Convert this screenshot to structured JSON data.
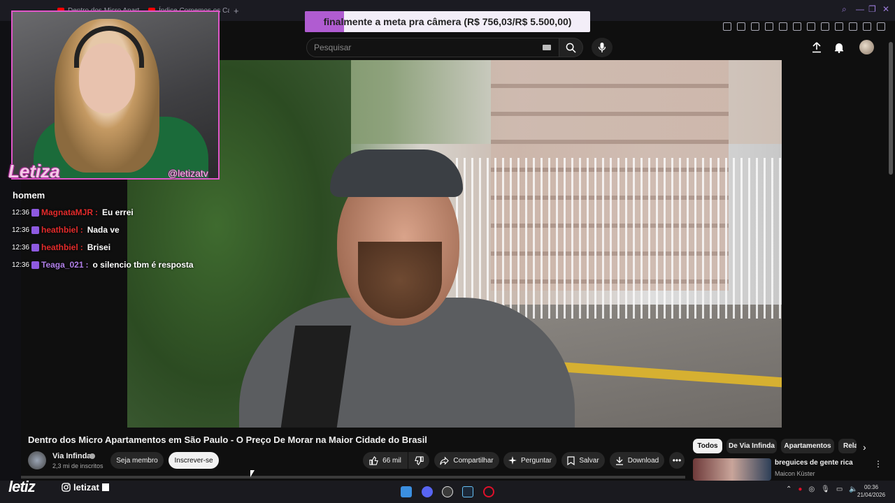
{
  "browser": {
    "tabs": [
      {
        "label": "Dentro dos Micro Apartamentos"
      },
      {
        "label": "Índice Comemos os Caminhos"
      }
    ]
  },
  "donation_goal": {
    "text": "finalmente a meta pra câmera (R$ 756,03/R$ 5.500,00)",
    "fraction": 0.137,
    "fill_color": "#b05cd1"
  },
  "youtube": {
    "search": {
      "placeholder": "Pesquisar",
      "value": ""
    },
    "video": {
      "title": "Dentro dos Micro Apartamentos em São Paulo - O Preço De Morar na Maior Cidade do Brasil",
      "channel": {
        "name": "Via Infinda",
        "subscribers": "2,3 mi de inscritos"
      },
      "buttons": {
        "member": "Seja membro",
        "subscribe": "Inscrever-se",
        "likes": "66 mil",
        "share": "Compartilhar",
        "ask": "Perguntar",
        "save": "Salvar",
        "download": "Download"
      }
    },
    "chips": [
      "Todos",
      "De Via Infinda",
      "Apartamentos",
      "Rela"
    ],
    "recommendation": {
      "title": "breguices de gente rica",
      "channel": "Maicon Küster"
    }
  },
  "stream_overlay": {
    "streamer_name": "Letiza",
    "handle": "@letizatv",
    "brand": "letiz",
    "instagram": "letizat",
    "chat": {
      "partial_top": "homem",
      "messages": [
        {
          "time": "12:36",
          "user": "MagnataMJR",
          "color": "#e32b2b",
          "text": "Eu errei"
        },
        {
          "time": "12:36",
          "user": "heathbiel",
          "color": "#e32b2b",
          "text": "Nada ve"
        },
        {
          "time": "12:36",
          "user": "heathbiel",
          "color": "#e32b2b",
          "text": "Brisei"
        },
        {
          "time": "12:36",
          "user": "Teaga_021",
          "color": "#b07fe8",
          "text": "o silencio tbm é resposta"
        }
      ]
    }
  },
  "taskbar": {
    "time": "00:36",
    "date": "21/04/2026"
  }
}
